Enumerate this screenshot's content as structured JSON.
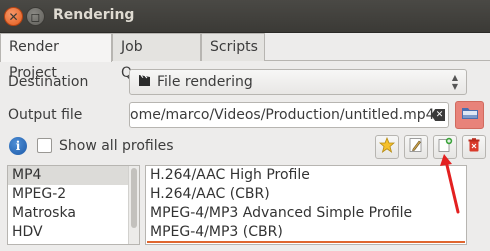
{
  "window": {
    "title": "Rendering",
    "close_symbol": "✕",
    "maximize_symbol": "◻"
  },
  "tabs": [
    {
      "label": "Render Project",
      "active": true
    },
    {
      "label": "Job Queue",
      "active": false
    },
    {
      "label": "Scripts",
      "active": false
    }
  ],
  "destination": {
    "label": "Destination",
    "value": "File rendering",
    "icon": "clapperboard-icon"
  },
  "output": {
    "label": "Output file",
    "value": "ome/marco/Videos/Production/untitled.mp4"
  },
  "profiles": {
    "show_all_label": "Show all profiles",
    "show_all_checked": false,
    "formats": [
      "MP4",
      "MPEG-2",
      "Matroska",
      "HDV"
    ],
    "selected_format": "MP4",
    "items": [
      "H.264/AAC High Profile",
      "H.264/AAC (CBR)",
      "MPEG-4/MP3 Advanced Simple Profile",
      "MPEG-4/MP3 (CBR)"
    ]
  },
  "toolbar": {
    "favorite_icon": "star-icon",
    "edit_icon": "edit-icon",
    "new_icon": "new-profile-icon",
    "delete_icon": "delete-icon"
  },
  "colors": {
    "accent": "#e0662f",
    "annotation_arrow": "#e32020",
    "folder_button": "#e8837a"
  }
}
